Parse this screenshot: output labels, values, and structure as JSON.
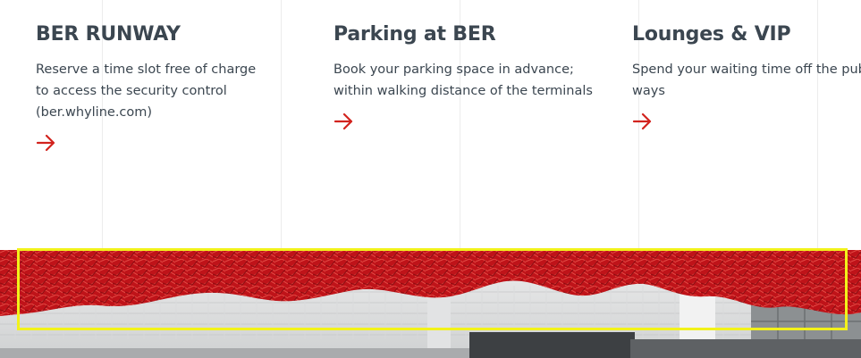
{
  "cards": [
    {
      "title": "BER RUNWAY",
      "description": "Reserve a time slot free of charge to access the security control (ber.whyline.com)",
      "arrow_icon": "arrow-right-icon"
    },
    {
      "title": "Parking at BER",
      "description": "Book your parking space in advance; within walking distance of the terminals",
      "arrow_icon": "arrow-right-icon"
    },
    {
      "title": "Lounges & VIP",
      "description": "Spend your waiting time off the public ways",
      "arrow_icon": "arrow-right-icon"
    }
  ],
  "colors": {
    "accent": "#d2231e",
    "text": "#3b4650",
    "sculpture_red": "#c8151b",
    "highlight": "#f2f21a"
  }
}
